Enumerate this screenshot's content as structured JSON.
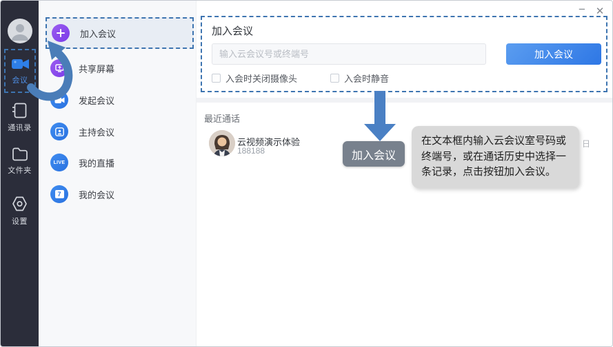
{
  "window": {
    "minimize_icon": "−",
    "close_icon": "✕"
  },
  "sidebar": {
    "items": [
      {
        "label": "会议",
        "active": true
      },
      {
        "label": "通讯录",
        "active": false
      },
      {
        "label": "文件夹",
        "active": false
      },
      {
        "label": "设置",
        "active": false
      }
    ]
  },
  "menu": {
    "items": [
      {
        "label": "加入会议",
        "icon": "plus-icon",
        "active": true
      },
      {
        "label": "共享屏幕",
        "icon": "screen-share-icon"
      },
      {
        "label": "发起会议",
        "icon": "video-camera-icon"
      },
      {
        "label": "主持会议",
        "icon": "host-meeting-icon"
      },
      {
        "label": "我的直播",
        "icon": "live-icon",
        "icon_text": "LIVE"
      },
      {
        "label": "我的会议",
        "icon": "calendar-icon",
        "icon_text": "7"
      }
    ]
  },
  "main": {
    "title": "加入会议",
    "input_placeholder": "输入云会议号或终端号",
    "join_button_label": "加入会议",
    "checkbox_camera_label": "入会时关闭摄像头",
    "checkbox_mute_label": "入会时静音",
    "recent_section_title": "最近通话",
    "recent_call": {
      "name": "云视频演示体验",
      "number": "188188"
    },
    "overlay_button_label": "加入会议",
    "tooltip_text": "在文本框内输入云会议室号码或终端号，或在通话历史中选择一条记录，点击按钮加入会议。",
    "partially_hidden_text": "日"
  },
  "colors": {
    "sidebar_bg": "#2b2d3a",
    "accent_blue": "#2e77e5",
    "annotation_blue": "#3d74b0",
    "purple_icon": "#7b3ce8",
    "tooltip_bg": "#d9d9d9",
    "overlay_button_bg": "#78818d"
  }
}
